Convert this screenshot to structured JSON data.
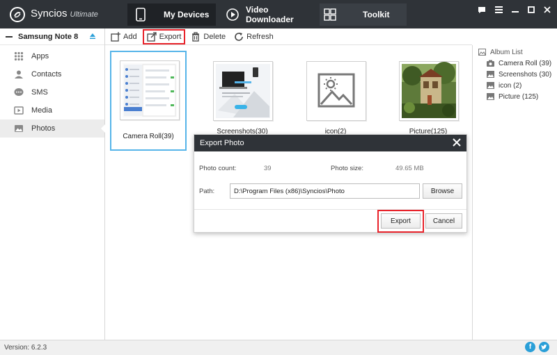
{
  "app": {
    "name": "Syncios",
    "edition": "Ultimate"
  },
  "nav_tabs": [
    {
      "label": "My Devices",
      "icon": "phone-icon",
      "active": true
    },
    {
      "label": "Video Downloader",
      "icon": "play-icon",
      "active": false
    },
    {
      "label": "Toolkit",
      "icon": "grid-icon",
      "active": false
    }
  ],
  "device": {
    "name": "Samsung Note 8"
  },
  "sidebar": {
    "items": [
      {
        "label": "Apps",
        "icon": "apps-icon"
      },
      {
        "label": "Contacts",
        "icon": "contacts-icon"
      },
      {
        "label": "SMS",
        "icon": "sms-icon"
      },
      {
        "label": "Media",
        "icon": "media-icon"
      },
      {
        "label": "Photos",
        "icon": "photos-icon",
        "selected": true
      }
    ]
  },
  "toolbar": {
    "add": "Add",
    "export": "Export",
    "delete": "Delete",
    "refresh": "Refresh"
  },
  "albums": [
    {
      "caption": "Camera Roll(39)",
      "selected": true
    },
    {
      "caption": "Screenshots(30)",
      "selected": false
    },
    {
      "caption": "icon(2)",
      "selected": false
    },
    {
      "caption": "Picture(125)",
      "selected": false
    }
  ],
  "album_list": {
    "header": "Album List",
    "items": [
      "Camera Roll (39)",
      "Screenshots (30)",
      "icon (2)",
      "Picture (125)"
    ]
  },
  "dialog": {
    "title": "Export Photo",
    "photo_count_label": "Photo count:",
    "photo_count": "39",
    "photo_size_label": "Photo size:",
    "photo_size": "49.65 MB",
    "path_label": "Path:",
    "path_value": "D:\\Program Files (x86)\\Syncios\\Photo",
    "browse": "Browse",
    "export": "Export",
    "cancel": "Cancel"
  },
  "status": {
    "version": "Version: 6.2.3"
  },
  "colors": {
    "dark": "#2f3338",
    "accent": "#56b4e9",
    "highlight": "#e8222a",
    "social": "#2a9fd8"
  }
}
